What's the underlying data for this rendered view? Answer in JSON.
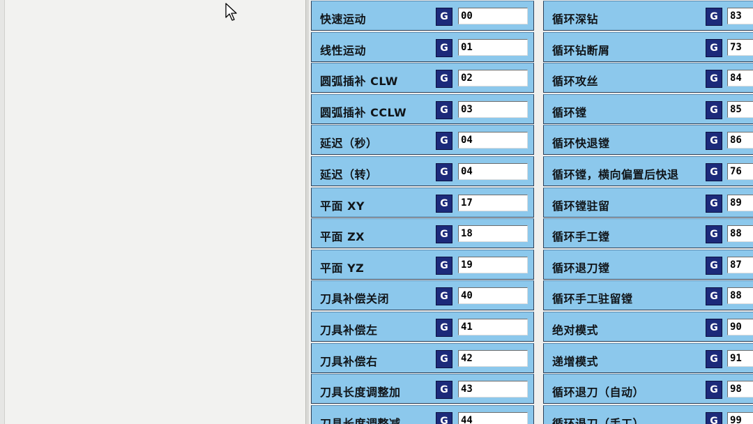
{
  "colors": {
    "row_bg": "#8cc8ec",
    "g_button_bg": "#1c2a7a",
    "field_bg": "#ffffff",
    "border": "#2c3e56"
  },
  "g_prefix": "G",
  "left_column": [
    {
      "label": "快速运动",
      "code": "00"
    },
    {
      "label": "线性运动",
      "code": "01"
    },
    {
      "label": "圆弧插补 CLW",
      "code": "02"
    },
    {
      "label": "圆弧插补 CCLW",
      "code": "03"
    },
    {
      "label": "延迟（秒）",
      "code": "04"
    },
    {
      "label": "延迟（转）",
      "code": "04"
    },
    {
      "label": "平面 XY",
      "code": "17"
    },
    {
      "label": "平面 ZX",
      "code": "18"
    },
    {
      "label": "平面 YZ",
      "code": "19"
    },
    {
      "label": "刀具补偿关闭",
      "code": "40"
    },
    {
      "label": "刀具补偿左",
      "code": "41"
    },
    {
      "label": "刀具补偿右",
      "code": "42"
    },
    {
      "label": "刀具长度调整加",
      "code": "43"
    },
    {
      "label": "刀具长度调整减",
      "code": "44"
    }
  ],
  "right_column": [
    {
      "label": "循环深钻",
      "code": "83"
    },
    {
      "label": "循环钻断屑",
      "code": "73"
    },
    {
      "label": "循环攻丝",
      "code": "84"
    },
    {
      "label": "循环镗",
      "code": "85"
    },
    {
      "label": "循环快退镗",
      "code": "86"
    },
    {
      "label": "循环镗，横向偏置后快退",
      "code": "76"
    },
    {
      "label": "循环镗驻留",
      "code": "89"
    },
    {
      "label": "循环手工镗",
      "code": "88"
    },
    {
      "label": "循环退刀镗",
      "code": "87"
    },
    {
      "label": "循环手工驻留镗",
      "code": "88"
    },
    {
      "label": "绝对模式",
      "code": "90"
    },
    {
      "label": "递增模式",
      "code": "91"
    },
    {
      "label": "循环退刀（自动）",
      "code": "98"
    },
    {
      "label": "循环退刀（手工）",
      "code": "99"
    }
  ]
}
